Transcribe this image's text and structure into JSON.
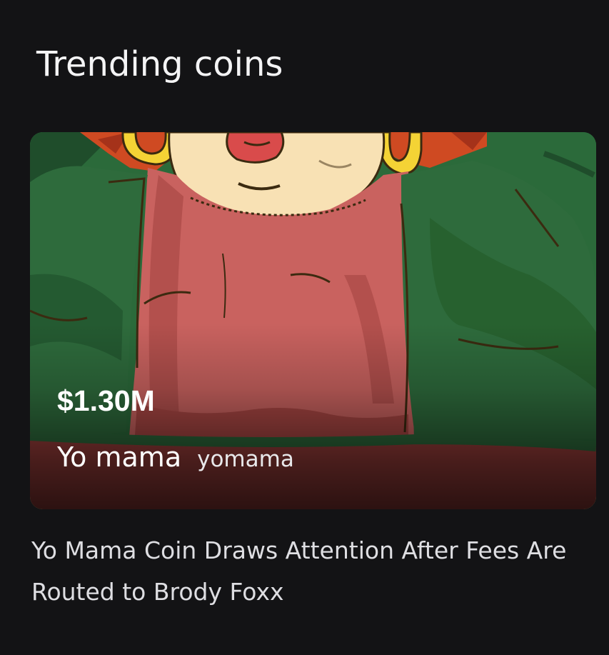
{
  "section": {
    "title": "Trending coins"
  },
  "coin": {
    "market_cap": "$1.30M",
    "name": "Yo mama",
    "ticker": "yomama",
    "image_icon": "coin-character-illustration"
  },
  "news": {
    "headline": "Yo Mama Coin Draws Attention After Fees Are Routed to Brody Foxx"
  },
  "colors": {
    "background": "#131315",
    "jacket_green": "#2e6b3c",
    "shirt_pink": "#c9625f",
    "hair_orange": "#d2431e",
    "earring_yellow": "#f3d233",
    "skin": "#f8e1b4"
  }
}
